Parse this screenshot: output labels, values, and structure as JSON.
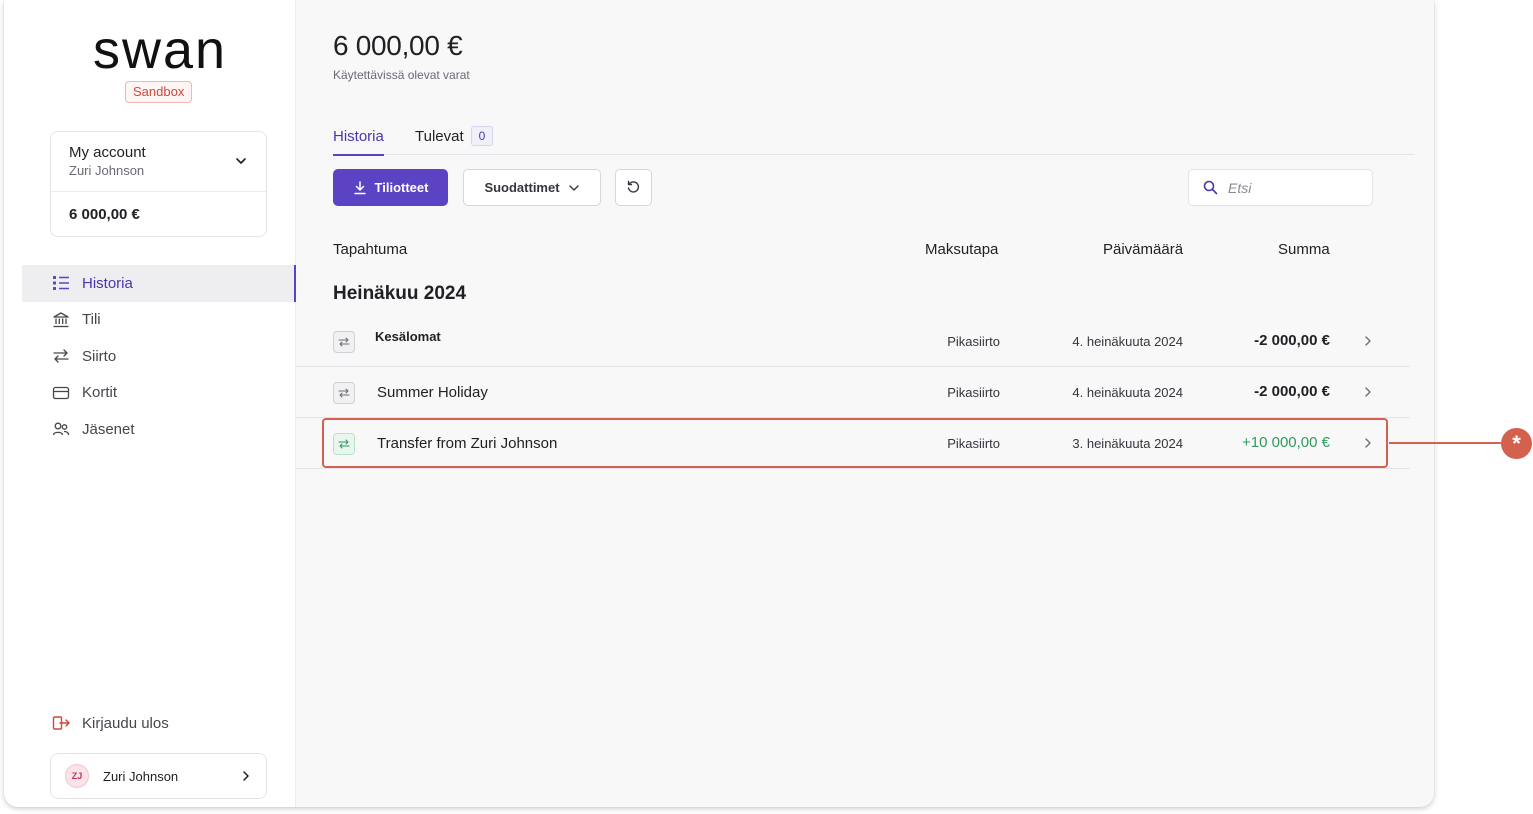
{
  "brand": {
    "logo_text": "swan",
    "env_badge": "Sandbox"
  },
  "account": {
    "name": "My account",
    "owner": "Zuri Johnson",
    "balance": "6 000,00 €"
  },
  "nav": {
    "items": [
      {
        "label": "Historia",
        "icon": "list-icon",
        "active": true
      },
      {
        "label": "Tili",
        "icon": "bank-icon",
        "active": false
      },
      {
        "label": "Siirto",
        "icon": "transfer-icon",
        "active": false
      },
      {
        "label": "Kortit",
        "icon": "card-icon",
        "active": false
      },
      {
        "label": "Jäsenet",
        "icon": "members-icon",
        "active": false
      }
    ],
    "logout": "Kirjaudu ulos"
  },
  "user": {
    "initials": "ZJ",
    "name": "Zuri Johnson"
  },
  "header": {
    "balance": "6 000,00 €",
    "balance_label": "Käytettävissä olevat varat"
  },
  "tabs": [
    {
      "label": "Historia",
      "active": true
    },
    {
      "label": "Tulevat",
      "badge": "0",
      "active": false
    }
  ],
  "toolbar": {
    "statements_label": "Tiliotteet",
    "filters_label": "Suodattimet",
    "search_placeholder": "Etsi"
  },
  "table": {
    "headers": {
      "transaction": "Tapahtuma",
      "method": "Maksutapa",
      "date": "Päivämäärä",
      "amount": "Summa"
    },
    "group": "Heinäkuu 2024",
    "rows": [
      {
        "label": "Kesälomat",
        "method": "Pikasiirto",
        "date": "4. heinäkuuta 2024",
        "amount": "-2 000,00 €",
        "direction": "out"
      },
      {
        "label": "Summer Holiday",
        "method": "Pikasiirto",
        "date": "4. heinäkuuta 2024",
        "amount": "-2 000,00 €",
        "direction": "out"
      },
      {
        "label": "Transfer from Zuri Johnson",
        "method": "Pikasiirto",
        "date": "3. heinäkuuta 2024",
        "amount": "+10 000,00 €",
        "direction": "in"
      }
    ]
  },
  "callout": {
    "symbol": "*"
  },
  "colors": {
    "accent": "#5b43c4",
    "positive": "#2e9a5b",
    "highlight": "#d4614e",
    "badge_red": "#d2473a"
  }
}
